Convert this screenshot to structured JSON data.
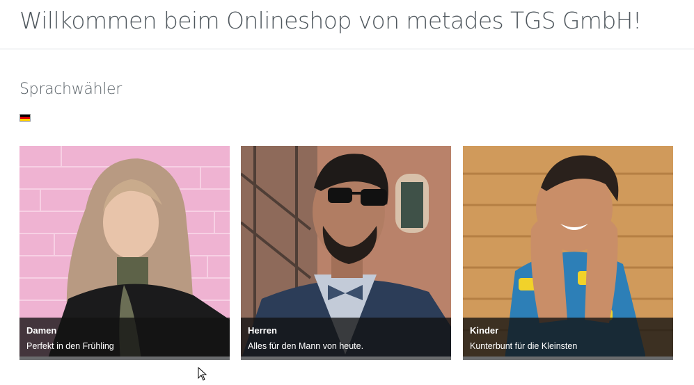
{
  "header": {
    "title": "Willkommen beim Onlineshop von metades TGS GmbH!"
  },
  "language": {
    "title": "Sprachwähler",
    "flag_icon": "german-flag-icon",
    "flag_colors": [
      "#000000",
      "#dd0000",
      "#ffce00"
    ]
  },
  "tiles": [
    {
      "title": "Damen",
      "subtitle": "Perfekt in den Frühling"
    },
    {
      "title": "Herren",
      "subtitle": "Alles für den Mann von heute."
    },
    {
      "title": "Kinder",
      "subtitle": "Kunterbunt für die Kleinsten"
    }
  ],
  "cursor_icon": "mouse-pointer-icon"
}
